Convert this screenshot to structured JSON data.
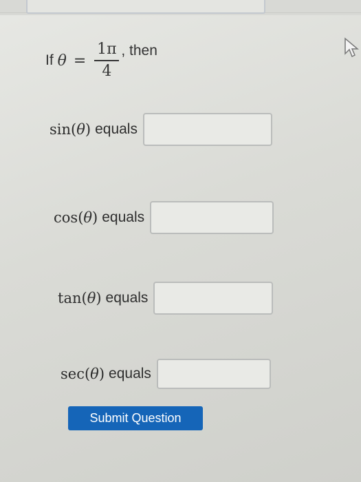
{
  "problem": {
    "if_text": "If",
    "theta": "θ",
    "equals_sign": "=",
    "numerator": "1π",
    "denominator": "4",
    "then_text": ", then"
  },
  "questions": [
    {
      "function": "sin",
      "theta": "θ",
      "equals_text": "equals",
      "value": ""
    },
    {
      "function": "cos",
      "theta": "θ",
      "equals_text": "equals",
      "value": ""
    },
    {
      "function": "tan",
      "theta": "θ",
      "equals_text": "equals",
      "value": ""
    },
    {
      "function": "sec",
      "theta": "θ",
      "equals_text": "equals",
      "value": ""
    }
  ],
  "submit_label": "Submit Question",
  "colors": {
    "submit_button": "#1565b8",
    "submit_text": "#ffffff",
    "input_border": "#babcbb"
  },
  "icons": {
    "cursor": "mouse-pointer-icon"
  }
}
